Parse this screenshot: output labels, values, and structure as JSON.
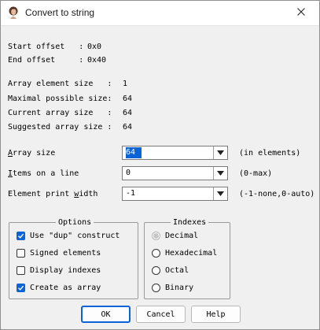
{
  "window": {
    "title": "Convert to string",
    "app_icon": "ida-portrait-icon",
    "close_icon": "close-icon"
  },
  "info": [
    {
      "label": "Start offset   :",
      "value": "0x0"
    },
    {
      "label": "End offset     :",
      "value": "0x40"
    },
    {
      "label": "Array element size   :",
      "value": "1"
    },
    {
      "label": "Maximal possible size:",
      "value": "64"
    },
    {
      "label": "Current array size   :",
      "value": "64"
    },
    {
      "label": "Suggested array size :",
      "value": "64"
    }
  ],
  "fields": {
    "array_size": {
      "label_hotkey": "A",
      "label_rest": "rray size",
      "value": "64",
      "hint": "(in elements)"
    },
    "items_on_line": {
      "label_hotkey": "I",
      "label_rest": "tems on a line",
      "value": "0",
      "hint": "(0-max)"
    },
    "element_print_width": {
      "label_before": "Element print ",
      "label_hotkey": "w",
      "label_after": "idth",
      "value": "-1",
      "hint": "(-1-none,0-auto)"
    }
  },
  "options": {
    "title": "Options",
    "items": [
      {
        "label": "Use \"dup\" construct",
        "checked": true
      },
      {
        "label": "Signed elements",
        "checked": false
      },
      {
        "label": "Display indexes",
        "checked": false
      },
      {
        "label": "Create as array",
        "checked": true
      }
    ]
  },
  "indexes": {
    "title": "Indexes",
    "items": [
      {
        "label": "Decimal",
        "selected": true
      },
      {
        "label": "Hexadecimal",
        "selected": false
      },
      {
        "label": "Octal",
        "selected": false
      },
      {
        "label": "Binary",
        "selected": false
      }
    ]
  },
  "buttons": {
    "ok": "OK",
    "cancel": "Cancel",
    "help": "Help"
  },
  "colors": {
    "accent": "#0a64d8",
    "dialog_bg": "#f0f0f0",
    "titlebar_bg": "#ffffff"
  }
}
